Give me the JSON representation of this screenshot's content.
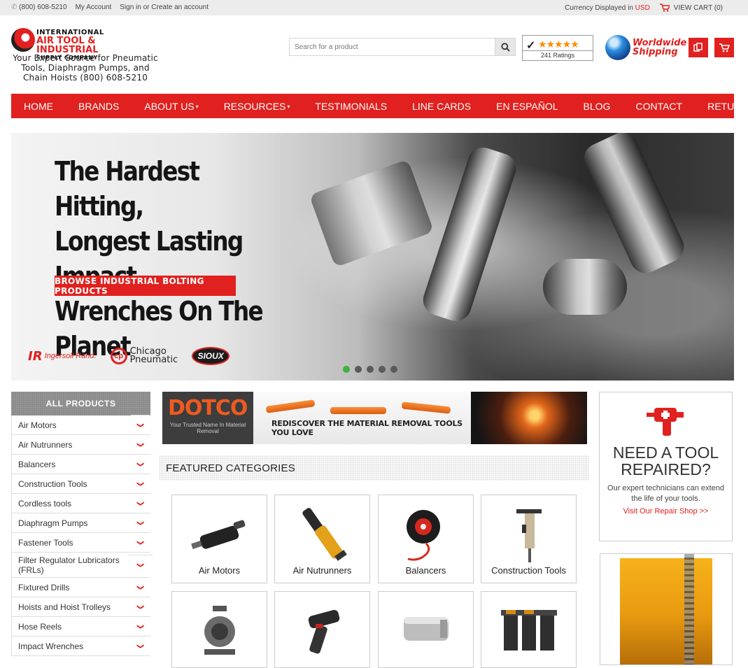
{
  "topbar": {
    "phone": "(800) 608-5210",
    "my_account": "My Account",
    "sign_in": "Sign in or Create an account",
    "currency_label": "Currency Displayed in",
    "currency": "USD",
    "view_cart": "VIEW CART (0)"
  },
  "logo": {
    "line1": "INTERNATIONAL",
    "line2": "AIR TOOL & INDUSTRIAL",
    "line3": "SUPPLY COMPANY",
    "tagline": "Your Expert Source for Pneumatic Tools, Diaphragm Pumps, and Chain Hoists (800) 608-5210"
  },
  "search": {
    "placeholder": "Search for a product"
  },
  "ratings": {
    "count": "241 Ratings",
    "stars": "★★★★★"
  },
  "shipping": {
    "line1": "Worldwide",
    "line2": "Shipping"
  },
  "nav": [
    {
      "label": "HOME"
    },
    {
      "label": "BRANDS"
    },
    {
      "label": "ABOUT US"
    },
    {
      "label": "RESOURCES"
    },
    {
      "label": "TESTIMONIALS"
    },
    {
      "label": "LINE CARDS"
    },
    {
      "label": "EN ESPAÑOL"
    },
    {
      "label": "BLOG"
    },
    {
      "label": "CONTACT"
    },
    {
      "label": "RETURNS"
    }
  ],
  "hero": {
    "headline_1": "The Hardest Hitting,",
    "headline_2": "Longest Lasting Impact",
    "headline_3": "Wrenches On The Planet",
    "cta": "BROWSE INDUSTRIAL BOLTING PRODUCTS",
    "brand_ir_mark": "IR",
    "brand_ir": "Ingersoll Rand.",
    "brand_cp_1": "Chicago",
    "brand_cp_2": "Pneumatic",
    "brand_sioux": "SIOUX"
  },
  "sidebar": {
    "title": "ALL PRODUCTS",
    "items": [
      "Air Motors",
      "Air Nutrunners",
      "Balancers",
      "Construction Tools",
      "Cordless tools",
      "Diaphragm Pumps",
      "Fastener Tools",
      "Filter Regulator Lubricators (FRLs)",
      "Fixtured Drills",
      "Hoists and Hoist Trolleys",
      "Hose Reels",
      "Impact Wrenches"
    ]
  },
  "promo": {
    "brand": "DOTCO",
    "brand_sub": "Your Trusted Name In Material Removal",
    "text": "REDISCOVER THE MATERIAL REMOVAL TOOLS YOU LOVE"
  },
  "featured": {
    "title": "FEATURED CATEGORIES",
    "categories": [
      "Air Motors",
      "Air Nutrunners",
      "Balancers",
      "Construction Tools"
    ]
  },
  "repair": {
    "title_1": "NEED A TOOL",
    "title_2": "REPAIRED?",
    "body": "Our expert technicians can extend the life of your tools.",
    "link": "Visit Our Repair Shop >>"
  }
}
